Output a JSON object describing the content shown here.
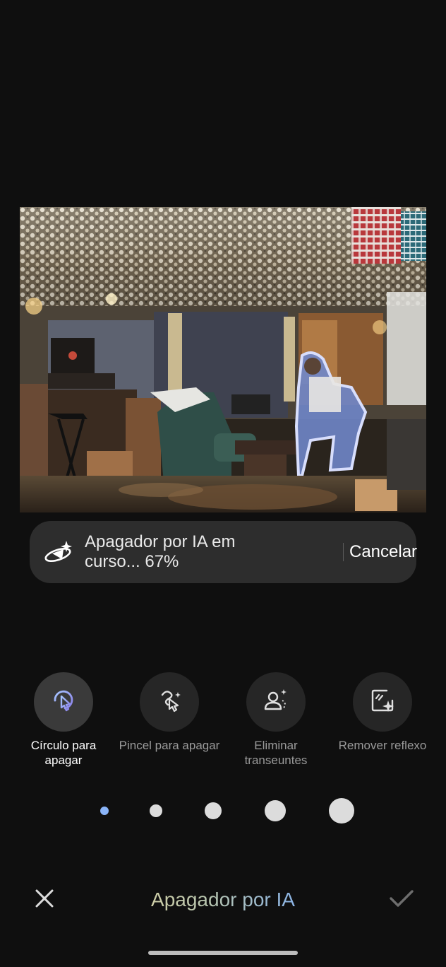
{
  "toast": {
    "icon": "ai-eraser-sparkle-icon",
    "message": "Apagador por IA em curso... 67%",
    "progress_percent": 67,
    "cancel_label": "Cancelar"
  },
  "tools": [
    {
      "label": "Círculo para apagar",
      "icon": "circle-to-erase-icon",
      "selected": true
    },
    {
      "label": "Pincel para apagar",
      "icon": "brush-erase-icon",
      "selected": false
    },
    {
      "label": "Eliminar transeuntes",
      "icon": "remove-passersby-icon",
      "selected": false
    },
    {
      "label": "Remover reflexo",
      "icon": "remove-reflection-icon",
      "selected": false
    }
  ],
  "brush_sizes": {
    "count": 5,
    "selected_index": 0,
    "selected_color": "#8ab4f8"
  },
  "bottom_bar": {
    "title": "Apagador por IA",
    "close_icon": "close-icon",
    "done_icon": "checkmark-icon"
  },
  "colors": {
    "background": "#0f0f0f",
    "toast_bg": "#2d2d2d",
    "tool_bg": "#262626",
    "accent_blue": "#8ab4f8",
    "selection_outline": "#b9c4ff"
  }
}
